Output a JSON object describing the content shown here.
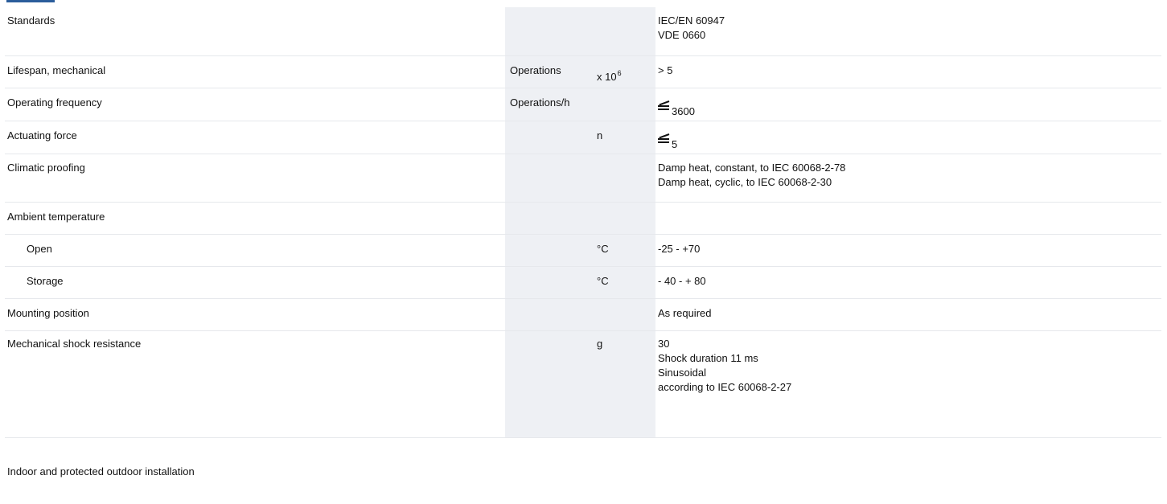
{
  "rows": [
    {
      "label": "Standards",
      "unit": "",
      "factor": "",
      "values": [
        "IEC/EN 60947",
        "VDE 0660"
      ]
    },
    {
      "label": "Lifespan, mechanical",
      "unit": "Operations",
      "factor_base": "x 10",
      "factor_exp": "6",
      "values": [
        "> 5"
      ]
    },
    {
      "label": "Operating frequency",
      "unit": "Operations/h",
      "factor": "",
      "value_symbol": "less-than-or-equal-icon",
      "value": "3600"
    },
    {
      "label": "Actuating force",
      "unit": "",
      "factor": "n",
      "value_symbol": "less-than-or-equal-icon",
      "value": "5"
    },
    {
      "label": "Climatic proofing",
      "unit": "",
      "factor": "",
      "values": [
        "Damp heat, constant, to IEC 60068-2-78",
        "Damp heat, cyclic, to IEC 60068-2-30"
      ]
    },
    {
      "label": "Ambient temperature",
      "unit": "",
      "factor": "",
      "values": []
    },
    {
      "label": "Open",
      "unit": "",
      "factor": "°C",
      "values": [
        "-25 - +70"
      ]
    },
    {
      "label": "Storage",
      "unit": "",
      "factor": "°C",
      "values": [
        "- 40 - + 80"
      ]
    },
    {
      "label": "Mounting position",
      "unit": "",
      "factor": "",
      "values": [
        "As required"
      ]
    },
    {
      "label": "Mechanical shock resistance",
      "unit": "",
      "factor": "g",
      "values": [
        "30",
        "Shock duration 11 ms",
        "Sinusoidal",
        "according to IEC 60068-2-27"
      ]
    }
  ],
  "footer_note": "Indoor and protected outdoor installation"
}
